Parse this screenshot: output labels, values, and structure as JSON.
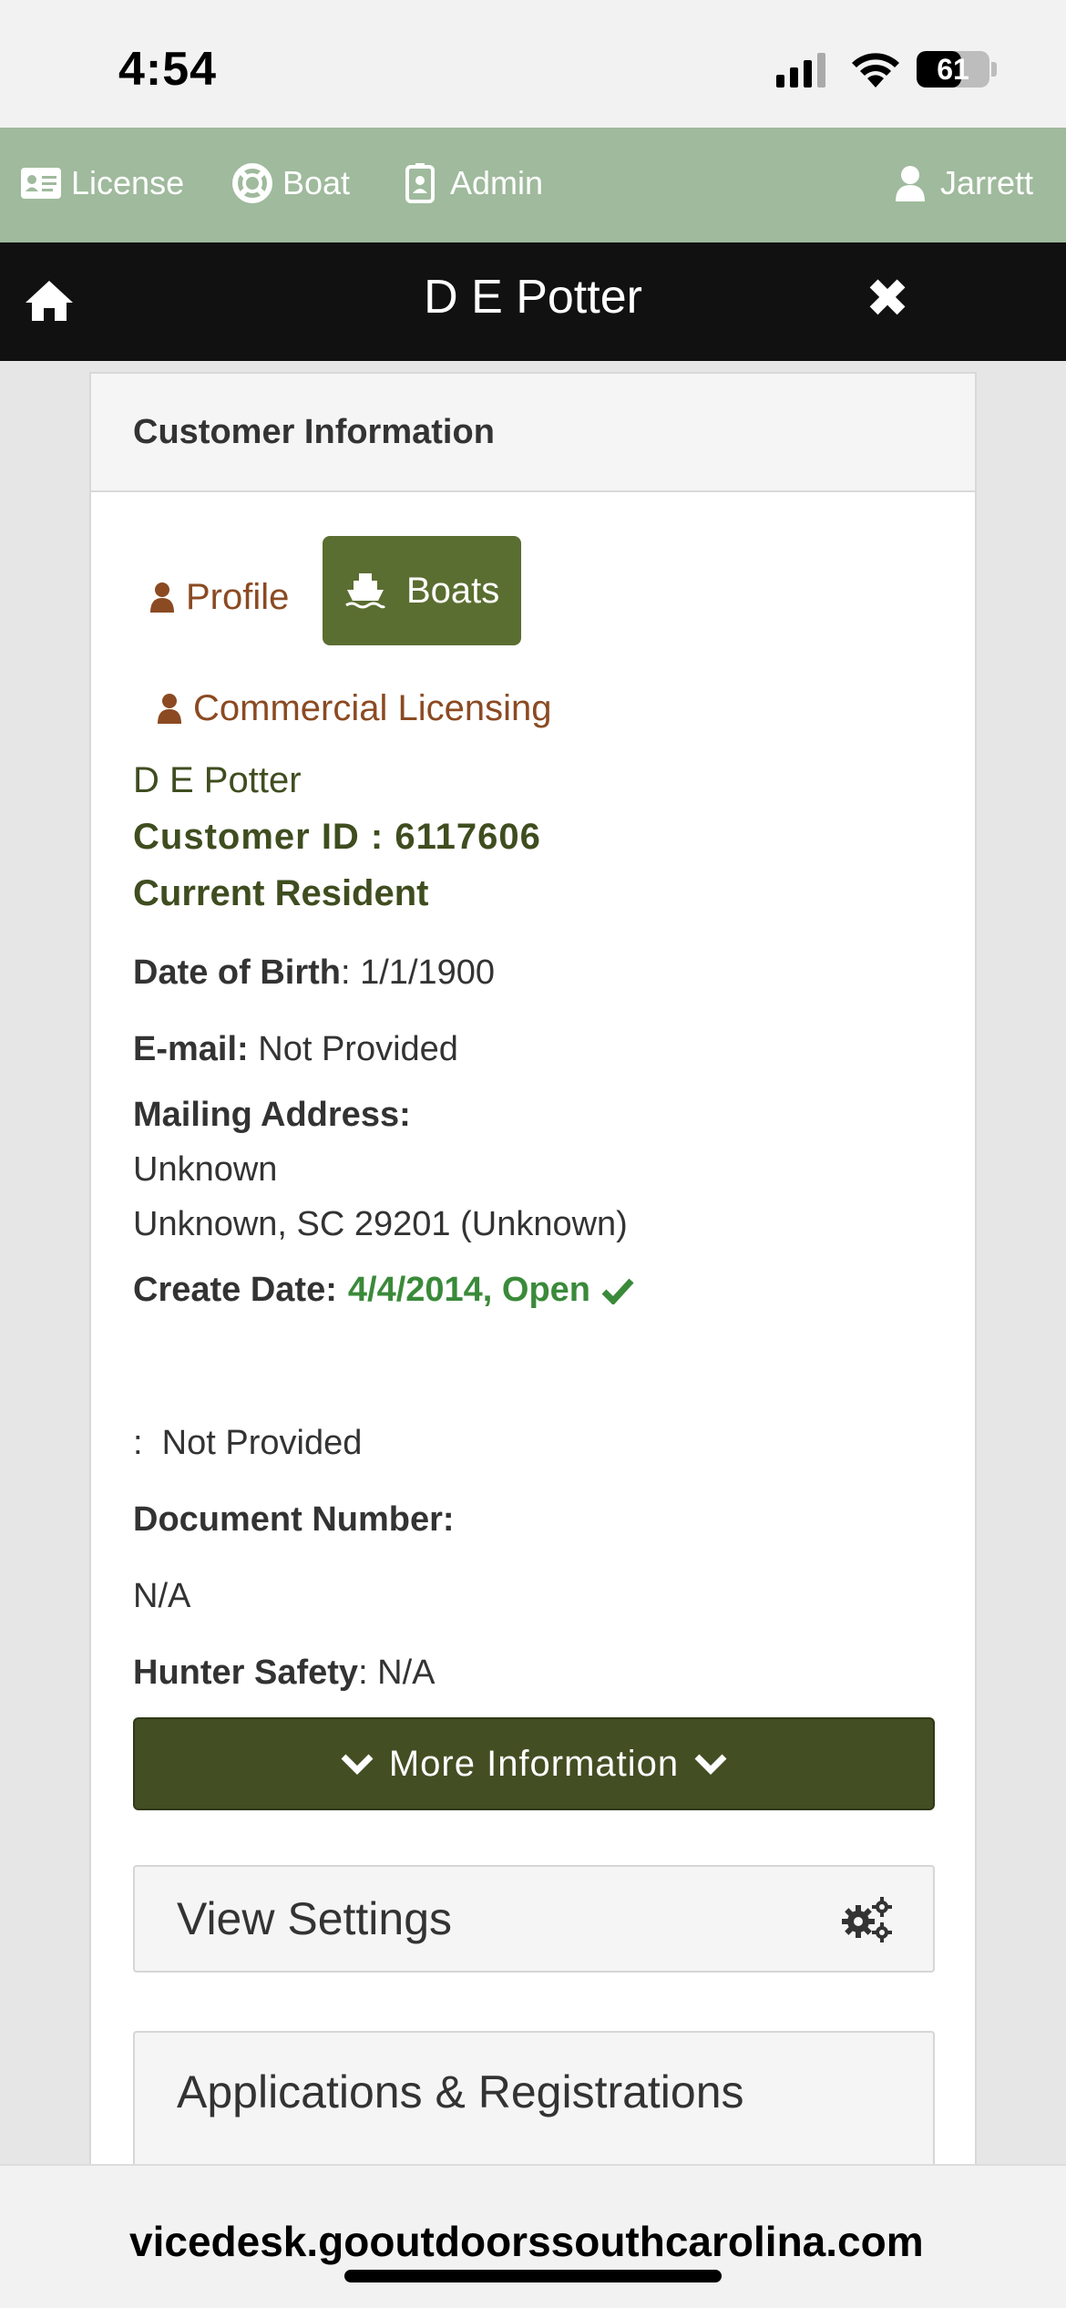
{
  "status": {
    "time": "4:54",
    "battery": "61",
    "battery_level": 0.61
  },
  "nav": {
    "license": "License",
    "boat": "Boat",
    "admin": "Admin",
    "user": "Jarrett"
  },
  "titlebar": {
    "title": "D E Potter",
    "home_icon": "home-icon",
    "close_icon": "close-icon"
  },
  "card": {
    "header": "Customer Information",
    "tabs": {
      "profile": "Profile",
      "boats": "Boats",
      "commercial": "Commercial Licensing"
    },
    "name": "D E Potter",
    "customer_id": "Customer ID : 6117606",
    "residency": "Current Resident",
    "dob_label": "Date of Birth",
    "dob_value": ": 1/1/1900",
    "email_label": "E-mail:",
    "email_value": " Not Provided",
    "mailing_label": "Mailing Address:",
    "mailing_line1": "Unknown",
    "mailing_line2": "Unknown, SC 29201 (Unknown)",
    "create_label": "Create Date:",
    "create_value": "4/4/2014, Open",
    "blank_field": ":  Not Provided",
    "document_label": "Document Number:",
    "document_value": "N/A",
    "hunter_label": "Hunter Safety",
    "hunter_value": ": N/A",
    "more_button": "More Information",
    "view_settings": "View Settings",
    "applications": "Applications & Registrations"
  },
  "browser": {
    "url": "vicedesk.gooutdoorssouthcarolina.com"
  },
  "colors": {
    "nav_green": "#9fba9c",
    "title_black": "#111111",
    "active_tab": "#5b6e31",
    "tab_brown": "#8b4a22",
    "olive_text": "#3f4d1f",
    "open_green": "#3a8a3a",
    "more_button": "#434e23"
  }
}
